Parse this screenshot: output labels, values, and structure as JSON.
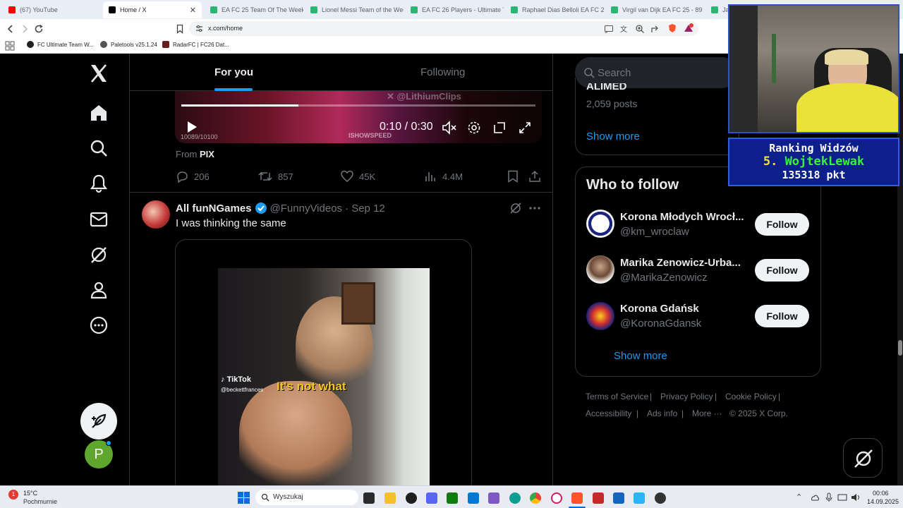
{
  "browser": {
    "tabs": [
      {
        "label": "(67) YouTube",
        "color": "#ff0000"
      },
      {
        "label": "Home / X",
        "color": "#000000",
        "active": true
      },
      {
        "label": "EA FC 25 Team Of The Week 1",
        "color": "#2bb673"
      },
      {
        "label": "Lionel Messi Team of the Wee",
        "color": "#2bb673"
      },
      {
        "label": "EA FC 26 Players - Ultimate Tea",
        "color": "#2bb673"
      },
      {
        "label": "Raphael Dias Belloli EA FC 26",
        "color": "#2bb673"
      },
      {
        "label": "Virgil van Dijk EA FC 25 - 89",
        "color": "#2bb673"
      },
      {
        "label": "Ja",
        "color": "#2bb673"
      }
    ],
    "url": "x.com/home",
    "bookmarks": [
      {
        "label": "FC Ultimate Team W...",
        "color": "#222222"
      },
      {
        "label": "Paletools v25.1.24",
        "color": "#444444"
      },
      {
        "label": "RadarFC | FC26 Dat...",
        "color": "#6a1b1b"
      }
    ]
  },
  "x": {
    "feed_tabs": {
      "for_you": "For you",
      "following": "Following"
    },
    "video1": {
      "watermark": "@LithiumClips",
      "channel": "ISHOWSPEED",
      "counter": "10089/10100",
      "time": "0:10 / 0:30",
      "progress": 0.33
    },
    "source": {
      "prefix": "From",
      "name": "PIX"
    },
    "actions1": {
      "replies": "206",
      "reposts": "857",
      "likes": "45K",
      "views": "4.4M"
    },
    "tweet2": {
      "name": "All funNGames",
      "handle": "@FunnyVideos",
      "date": "· Sep 12",
      "text": "I was thinking the same",
      "tiktok_label": "TikTok",
      "tiktok_handle": "@beckettfrances",
      "caption": "It's not what"
    },
    "search_placeholder": "Search",
    "trend": {
      "title": "ALIMED",
      "posts": "2,059 posts",
      "show_more": "Show more"
    },
    "who_to_follow": {
      "title": "Who to follow",
      "follow_label": "Follow",
      "accounts": [
        {
          "name": "Korona Młodych Wrocł...",
          "handle": "@km_wroclaw"
        },
        {
          "name": "Marika Zenowicz-Urba...",
          "handle": "@MarikaZenowicz"
        },
        {
          "name": "Korona Gdańsk",
          "handle": "@KoronaGdansk"
        }
      ],
      "show_more": "Show more"
    },
    "footer": {
      "terms": "Terms of Service",
      "privacy": "Privacy Policy",
      "cookie": "Cookie Policy",
      "accessibility": "Accessibility",
      "ads": "Ads info",
      "more": "More ···",
      "copyright": "© 2025 X Corp.",
      "sep": "|"
    },
    "avatar_letter": "P"
  },
  "overlay": {
    "ranking_title": "Ranking Widzów",
    "ranking_rank": "5.",
    "ranking_name": "WojtekLewak",
    "ranking_points": "135318 pkt"
  },
  "taskbar": {
    "weather_temp": "15°C",
    "weather_desc": "Pochmurnie",
    "notif_count": "1",
    "search_placeholder": "Wyszukaj",
    "time": "00:06",
    "date": "14.09.2025"
  },
  "colors": {
    "accent": "#1d9bf0",
    "verified": "#1d9bf0",
    "ranking_name": "#3cf03c",
    "ranking_text": "#ffffff"
  }
}
